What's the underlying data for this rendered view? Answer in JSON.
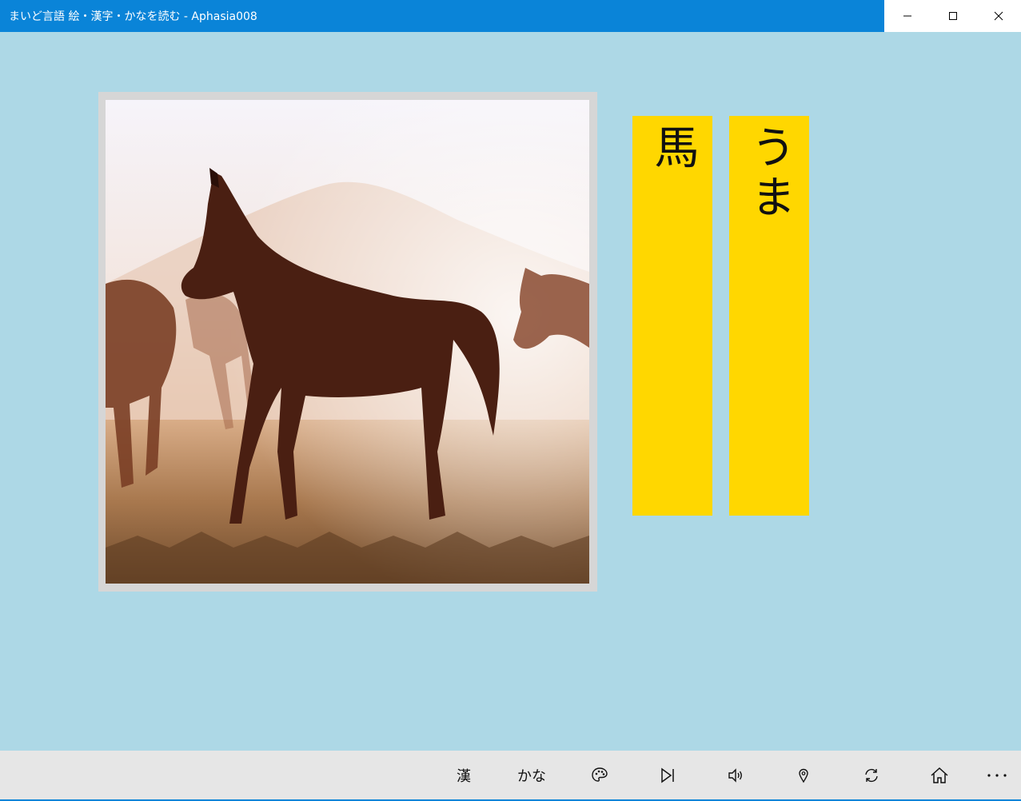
{
  "window": {
    "title": "まいど言語 絵・漢字・かなを読む - Aphasia008",
    "controls": [
      "minimize-icon",
      "maximize-icon",
      "close-icon"
    ]
  },
  "picture": {
    "subject": "horse-photo"
  },
  "cards": {
    "kanji": "馬",
    "kana": "うま"
  },
  "appbar": {
    "kanji_label": "漢",
    "kana_label": "かな",
    "icons": [
      "palette-icon",
      "play-next-icon",
      "volume-icon",
      "map-pin-icon",
      "refresh-icon",
      "home-icon",
      "more-icon"
    ]
  },
  "colors": {
    "background": "#add8e6",
    "titlebar": "#0a84d8",
    "card": "#ffd700",
    "appbar": "#e6e6e6"
  }
}
